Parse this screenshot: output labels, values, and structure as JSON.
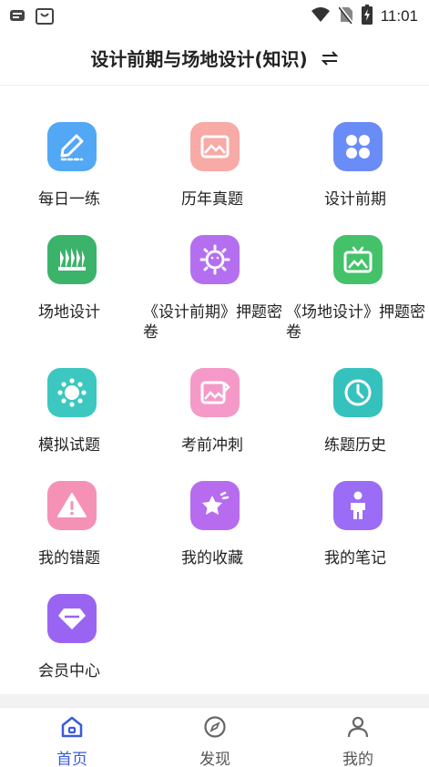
{
  "status_bar": {
    "time": "11:01"
  },
  "header": {
    "title": "设计前期与场地设计(知识)"
  },
  "tiles": [
    {
      "label": "每日一练",
      "color": "#52a8f5",
      "icon": "pen-icon"
    },
    {
      "label": "历年真题",
      "color": "#f7aaa6",
      "icon": "picture-icon"
    },
    {
      "label": "设计前期",
      "color": "#6a8cf7",
      "icon": "grid-icon"
    },
    {
      "label": "场地设计",
      "color": "#3cb36a",
      "icon": "forest-icon"
    },
    {
      "label": "《设计前期》押题密卷",
      "color": "#b46ff0",
      "icon": "sun-icon"
    },
    {
      "label": "《场地设计》押题密卷",
      "color": "#43c26a",
      "icon": "tv-icon"
    },
    {
      "label": "模拟试题",
      "color": "#3cc7c0",
      "icon": "flower-icon"
    },
    {
      "label": "考前冲刺",
      "color": "#f59ac8",
      "icon": "image-edit-icon"
    },
    {
      "label": "练题历史",
      "color": "#35c2bd",
      "icon": "clock-icon"
    },
    {
      "label": "我的错题",
      "color": "#f591b5",
      "icon": "warning-icon"
    },
    {
      "label": "我的收藏",
      "color": "#b76cf0",
      "icon": "star-icon"
    },
    {
      "label": "我的笔记",
      "color": "#9b6cf5",
      "icon": "person-icon"
    },
    {
      "label": "会员中心",
      "color": "#9a64f2",
      "icon": "diamond-icon"
    }
  ],
  "nav": [
    {
      "label": "首页",
      "icon": "home-icon",
      "active": true
    },
    {
      "label": "发现",
      "icon": "compass-icon",
      "active": false
    },
    {
      "label": "我的",
      "icon": "user-icon",
      "active": false
    }
  ],
  "colors": {
    "accent": "#3b5bdb"
  }
}
